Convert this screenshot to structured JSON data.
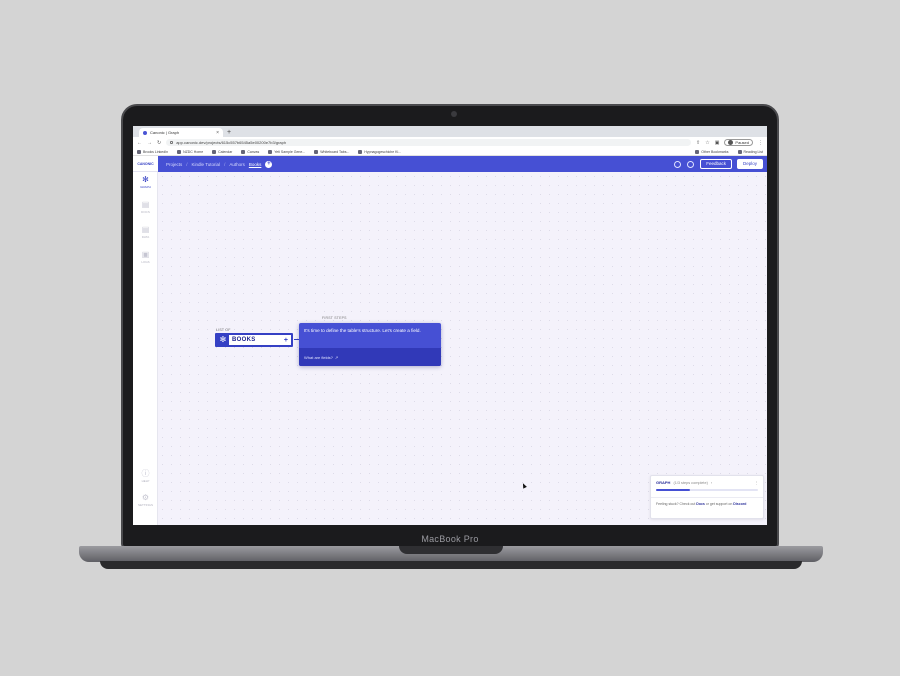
{
  "device": {
    "brand": "MacBook Pro"
  },
  "browser": {
    "tab_title": "Canonic | Graph",
    "tab_close": "×",
    "new_tab": "+",
    "url": "app.canonic.dev/projects/615c557b6545a5e00200e7b3/graph",
    "profile_label": "Paused",
    "bookmarks": [
      "Brooks LinkedIn",
      "NZDC Home",
      "Calendar",
      "Canvas",
      "Yeti Sample Gene...",
      "Whiteboard Tabs...",
      "Hypnagogeschiche Ki..."
    ],
    "bookmarks_right": [
      "Other Bookmarks",
      "Reading List"
    ]
  },
  "app": {
    "logo": "CANONIC",
    "breadcrumbs": [
      "Projects",
      "Kindle Tutorial",
      "Authors",
      "Books"
    ],
    "header_buttons": {
      "feedback": "Feedback",
      "deploy": "Deploy"
    },
    "sidebar": {
      "items": [
        {
          "label": "GRAPH",
          "icon": "graph-icon"
        },
        {
          "label": "DOCS",
          "icon": "docs-icon"
        },
        {
          "label": "DATA",
          "icon": "data-icon"
        },
        {
          "label": "LOGS",
          "icon": "logs-icon"
        }
      ],
      "bottom": [
        {
          "label": "HELP",
          "icon": "help-icon"
        },
        {
          "label": "SETTINGS",
          "icon": "settings-icon"
        }
      ]
    },
    "node": {
      "caption": "LIST OF",
      "name": "BOOKS"
    },
    "tooltip": {
      "caption": "FIRST STEPS",
      "message": "It's time to define the table's structure. Let's create a field.",
      "footer": "What are fields?"
    },
    "progress": {
      "title": "GRAPH",
      "status": "(1/3 steps complete)",
      "fraction": 0.33,
      "body_pre": "Feeling stuck? Check out",
      "body_link": "Docs",
      "body_mid": "or get support on",
      "body_link2": "Discord"
    },
    "accent_color": "#4650d4"
  }
}
